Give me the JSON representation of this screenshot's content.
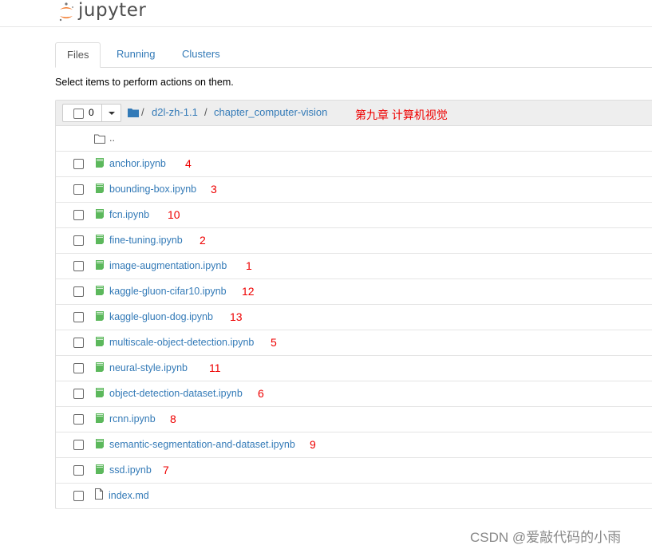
{
  "app": {
    "title": "jupyter"
  },
  "tabs": [
    {
      "label": "Files",
      "active": true
    },
    {
      "label": "Running",
      "active": false
    },
    {
      "label": "Clusters",
      "active": false
    }
  ],
  "instructions": "Select items to perform actions on them.",
  "toolbar": {
    "selected_count": "0"
  },
  "breadcrumb": {
    "sep": "/",
    "items": [
      "d2l-zh-1.1",
      "chapter_computer-vision"
    ]
  },
  "annotation_header": "第九章 计算机视觉",
  "parent_link": "..",
  "files": [
    {
      "name": "anchor.ipynb",
      "type": "notebook",
      "num": "4"
    },
    {
      "name": "bounding-box.ipynb",
      "type": "notebook",
      "num": "3"
    },
    {
      "name": "fcn.ipynb",
      "type": "notebook",
      "num": "10"
    },
    {
      "name": "fine-tuning.ipynb",
      "type": "notebook",
      "num": "2"
    },
    {
      "name": "image-augmentation.ipynb",
      "type": "notebook",
      "num": "1"
    },
    {
      "name": "kaggle-gluon-cifar10.ipynb",
      "type": "notebook",
      "num": "12"
    },
    {
      "name": "kaggle-gluon-dog.ipynb",
      "type": "notebook",
      "num": "13"
    },
    {
      "name": "multiscale-object-detection.ipynb",
      "type": "notebook",
      "num": "5"
    },
    {
      "name": "neural-style.ipynb",
      "type": "notebook",
      "num": "11"
    },
    {
      "name": "object-detection-dataset.ipynb",
      "type": "notebook",
      "num": "6"
    },
    {
      "name": "rcnn.ipynb",
      "type": "notebook",
      "num": "8"
    },
    {
      "name": "semantic-segmentation-and-dataset.ipynb",
      "type": "notebook",
      "num": "9"
    },
    {
      "name": "ssd.ipynb",
      "type": "notebook",
      "num": "7"
    },
    {
      "name": "index.md",
      "type": "file",
      "num": ""
    }
  ],
  "watermark": "CSDN @爱敲代码的小雨",
  "colors": {
    "link": "#337ab7",
    "notebook_icon": "#5cb85c",
    "annotation": "#e00000",
    "logo_orange": "#f37726"
  }
}
